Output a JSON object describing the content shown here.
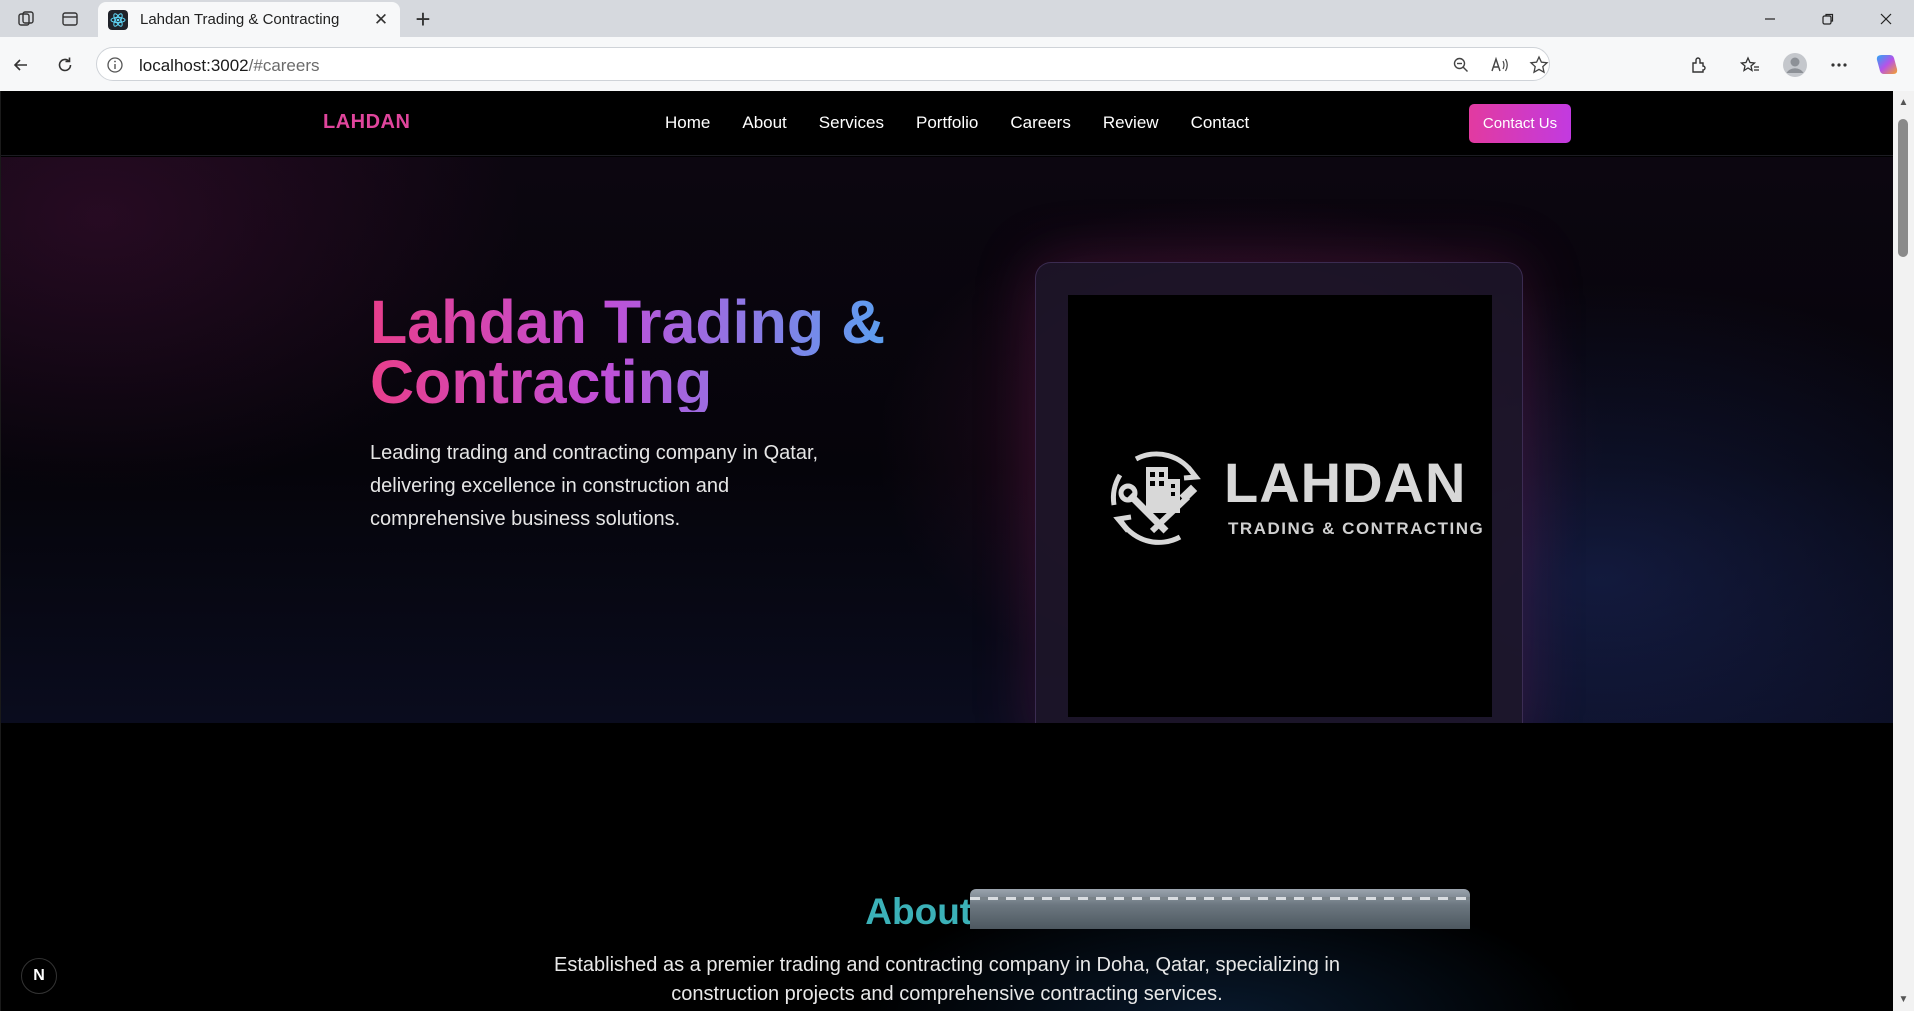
{
  "browser": {
    "tab_title": "Lahdan Trading & Contracting",
    "url_host": "localhost:3002",
    "url_path": "/#careers"
  },
  "nav": {
    "brand": "LAHDAN",
    "links": [
      "Home",
      "About",
      "Services",
      "Portfolio",
      "Careers",
      "Review",
      "Contact"
    ],
    "cta": "Contact Us"
  },
  "hero": {
    "title": "Lahdan Trading & Contracting",
    "subtitle": "Leading trading and contracting company in Qatar, delivering excellence in construction and comprehensive business solutions."
  },
  "logo": {
    "wordmark": "LAHDAN",
    "tagline": "TRADING & CONTRACTING"
  },
  "about": {
    "title": "About Us",
    "text": "Established as a premier trading and contracting company in Doha, Qatar, specializing in construction projects and comprehensive contracting services."
  },
  "badge": "N",
  "colors": {
    "brand_pink": "#e0459c",
    "cta_gradient_start": "#e23aa0",
    "cta_gradient_end": "#c23ae0",
    "about_title": "#3bb1b8"
  }
}
